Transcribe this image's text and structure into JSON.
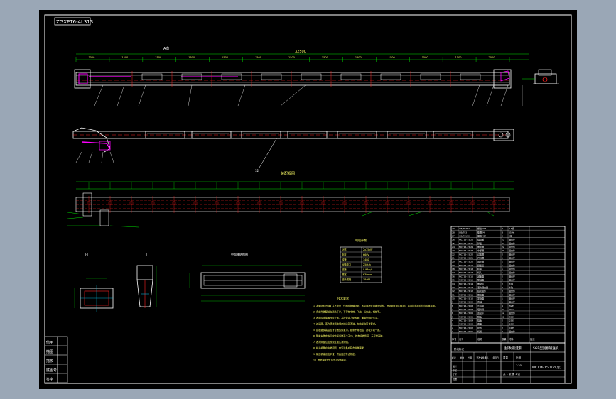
{
  "drawing": {
    "title_stamp": "ZGXPT6-4L313",
    "drawing_name": "刮板输送机",
    "drawing_number": "MCT16-15.10d(总)",
    "subtitle": "SGB型刮板输送机",
    "section_top_label": "A向",
    "section_label_mid": "装配视图",
    "detail_a_label": "I-I",
    "detail_b_label": "II",
    "detail_c_label": "中部槽结构图",
    "legend_title": "电机参数",
    "notes_title": "技术要求",
    "notes": [
      "1. 本输送机为煤矿井下综采工作面刮板输送机，其中部槽采用铸造结构，槽帮钢采用Q345B，其余材料均应符合国家标准。",
      "2. 各部件装配前应清洗干净，不得有毛刺、飞边、氧化皮、锈蚀等。",
      "3. 各部件连接螺栓应拧紧，并按规定力矩预紧，弹簧垫圈应压平。",
      "4. 减速器、液力耦合器按规定加注润滑油，加油量应符合要求。",
      "5. 刮板链安装后应有合适的预紧力，链条不得扭结，刮板方向一致。",
      "6. 整机安装完毕后应空载运转不少于2h，检查运转情况，无异常声响。",
      "7. 各润滑部位应按规定加注润滑脂。",
      "8. 机头机尾应安装牢固，电气设备应符合防爆要求。",
      "9. 输送机铺设应平直，弯曲度应符合规定。",
      "10. 其余按MT/T 105-2006执行。"
    ],
    "dims_top": [
      "3000",
      "1500",
      "1500",
      "1500",
      "1500",
      "1500",
      "1500",
      "1500",
      "1500",
      "1500",
      "1500",
      "1500",
      "2000"
    ],
    "overall_length": "32500"
  },
  "legend_rows": [
    [
      "功率",
      "2x75kW"
    ],
    [
      "电压",
      "660V"
    ],
    [
      "转速",
      "1480"
    ],
    [
      "运输能力",
      "250t/h"
    ],
    [
      "链速",
      "0.93m/s"
    ],
    [
      "槽宽",
      "630mm"
    ],
    [
      "链条规格",
      "18x64"
    ]
  ],
  "bom_header": [
    "序号",
    "代号",
    "名称",
    "数量",
    "材料",
    "备注"
  ],
  "bom_rows": [
    [
      "29",
      "GB/T5782",
      "螺栓M24",
      "8",
      "8.8级",
      ""
    ],
    [
      "28",
      "GB/T93",
      "垫圈24",
      "8",
      "65Mn",
      ""
    ],
    [
      "27",
      "GB/T6170",
      "螺母M24",
      "8",
      "8级",
      ""
    ],
    [
      "26",
      "MCT16-15.26",
      "挡煤板",
      "22",
      "组合件",
      ""
    ],
    [
      "25",
      "MCT16-15.25",
      "铲板",
      "22",
      "组合件",
      ""
    ],
    [
      "24",
      "MCT16-15.24",
      "电缆槽",
      "22",
      "组合件",
      ""
    ],
    [
      "23",
      "MCT16-15.23",
      "中部槽",
      "20",
      "组合件",
      ""
    ],
    [
      "22",
      "MCT16-15.22",
      "过渡槽",
      "2",
      "组合件",
      ""
    ],
    [
      "21",
      "MCT16-15.21",
      "开口槽",
      "1",
      "组合件",
      ""
    ],
    [
      "20",
      "MCT16-15.20",
      "调节槽",
      "1",
      "组合件",
      ""
    ],
    [
      "19",
      "MCT16-15.19",
      "刮板链",
      "1",
      "组合件",
      ""
    ],
    [
      "18",
      "MCT16-15.18",
      "机尾",
      "1",
      "组合件",
      ""
    ],
    [
      "17",
      "MCT16-15.17",
      "机头",
      "1",
      "组合件",
      ""
    ],
    [
      "16",
      "MCT16-15.16",
      "减速器",
      "2",
      "组合件",
      ""
    ],
    [
      "15",
      "MCT16-15.15",
      "联轴器",
      "2",
      "组合件",
      ""
    ],
    [
      "14",
      "MCT16-15.14",
      "电动机",
      "2",
      "外购",
      ""
    ],
    [
      "13",
      "MCT16-15.13",
      "液力耦合器",
      "2",
      "外购",
      ""
    ],
    [
      "12",
      "MCT16-15.12",
      "链轮组件",
      "2",
      "组合件",
      ""
    ],
    [
      "11",
      "MCT16-15.11",
      "拨链器",
      "2",
      "组合件",
      ""
    ],
    [
      "10",
      "MCT16-15.10",
      "紧链器",
      "1",
      "组合件",
      ""
    ],
    [
      "9",
      "MCT16-15.09",
      "盲轴",
      "1",
      "组合件",
      ""
    ],
    [
      "8",
      "MCT16-15.08",
      "压链块",
      "4",
      "ZG35",
      ""
    ],
    [
      "7",
      "MCT16-15.07",
      "哑铃销",
      "44",
      "40Cr",
      ""
    ],
    [
      "6",
      "MCT16-15.06",
      "连接环",
      "12",
      "组合件",
      ""
    ],
    [
      "5",
      "MCT16-15.05",
      "刮板",
      "52",
      "ZG35",
      ""
    ],
    [
      "4",
      "MCT16-15.04",
      "挡板",
      "2",
      "Q235",
      ""
    ],
    [
      "3",
      "MCT16-15.03",
      "底座",
      "2",
      "Q235",
      ""
    ],
    [
      "2",
      "MCT16-15.02",
      "护罩",
      "2",
      "Q235",
      ""
    ],
    [
      "1",
      "MCT16-15.01",
      "机架",
      "2",
      "组合件",
      ""
    ]
  ],
  "title_block": {
    "cols": [
      "标记",
      "处数",
      "分区",
      "更改文件号",
      "签名",
      "年月日"
    ],
    "rows": [
      "设计",
      "审核",
      "工艺",
      "批准"
    ],
    "stage": "阶段标记",
    "weight": "重量",
    "scale": "比例",
    "scale_value": "1:20",
    "sheet": "共 1 张 第 1 张"
  },
  "left_strip": [
    "借用",
    "描图",
    "描校",
    "底图号",
    "签字"
  ]
}
